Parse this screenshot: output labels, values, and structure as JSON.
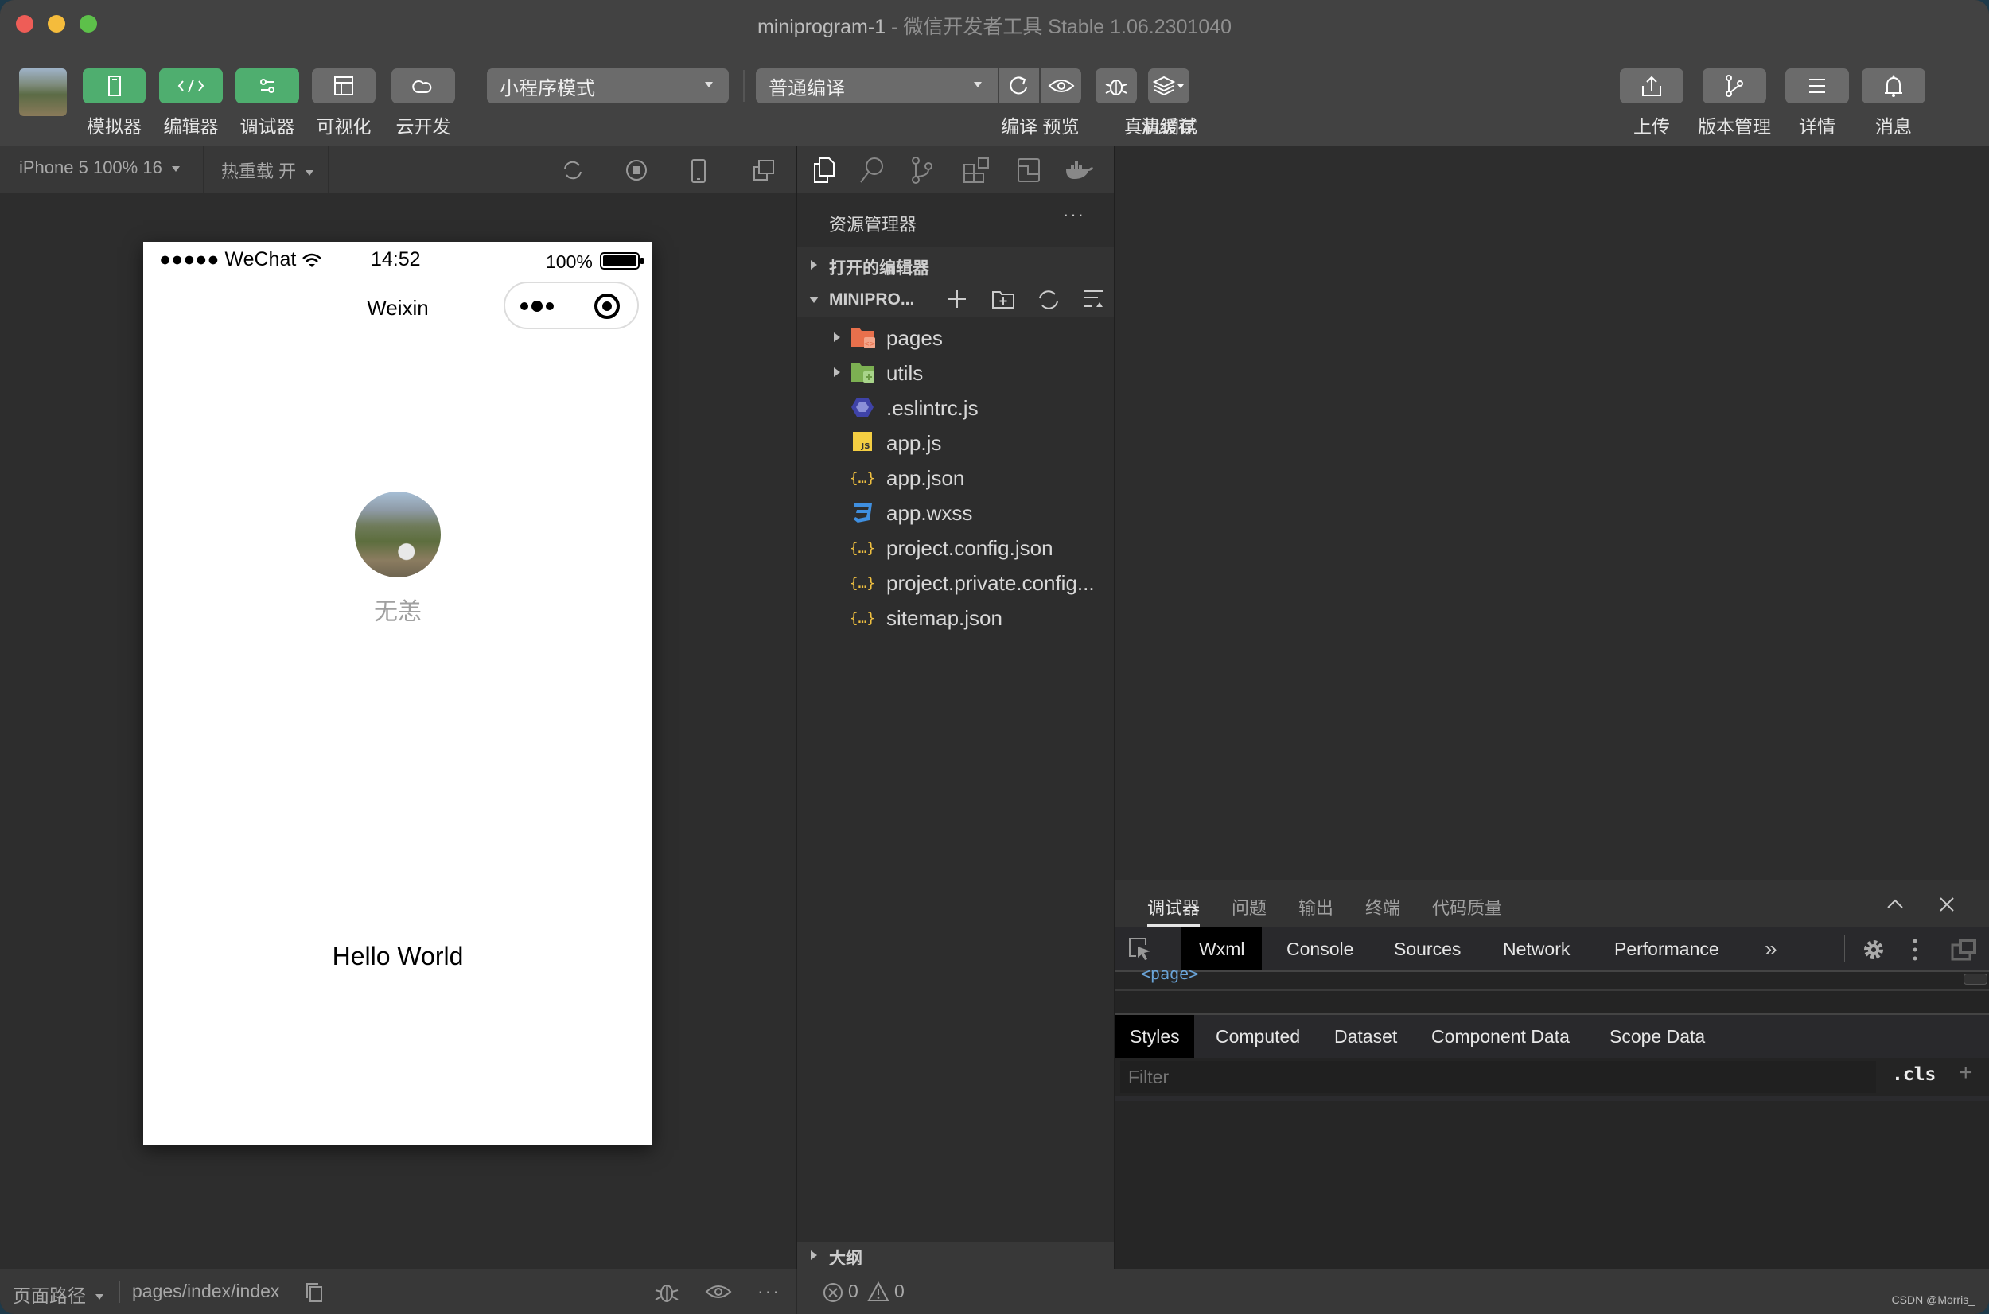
{
  "window": {
    "title_main": "miniprogram-1",
    "title_sub": " - 微信开发者工具 Stable 1.06.2301040"
  },
  "toolbar": {
    "left_buttons": [
      {
        "label": "模拟器",
        "icon": "phone-icon",
        "active": true
      },
      {
        "label": "编辑器",
        "icon": "code-icon",
        "active": true
      },
      {
        "label": "调试器",
        "icon": "debug-sliders-icon",
        "active": true
      },
      {
        "label": "可视化",
        "icon": "layout-icon",
        "active": false
      },
      {
        "label": "云开发",
        "icon": "cloud-icon",
        "active": false
      }
    ],
    "mode_select": "小程序模式",
    "compile_select": "普通编译",
    "center_buttons": [
      {
        "label": "编译",
        "icon": "refresh-icon"
      },
      {
        "label": "预览",
        "icon": "eye-icon"
      },
      {
        "label": "真机调试",
        "icon": "bug-icon"
      },
      {
        "label": "清缓存",
        "icon": "layers-icon"
      }
    ],
    "right_buttons": [
      {
        "label": "上传",
        "icon": "upload-icon"
      },
      {
        "label": "版本管理",
        "icon": "branch-icon"
      },
      {
        "label": "详情",
        "icon": "menu-icon"
      },
      {
        "label": "消息",
        "icon": "bell-icon"
      }
    ],
    "accent_color": "#4fae6f"
  },
  "simulator": {
    "device_select": "iPhone 5 100% 16",
    "hot_reload": "热重载 开",
    "phone": {
      "status_left": "●●●●● WeChat",
      "time": "14:52",
      "battery": "100%",
      "nav_title": "Weixin",
      "nickname": "无恙",
      "body_text": "Hello World"
    }
  },
  "explorer": {
    "header": "资源管理器",
    "more": "···",
    "open_editors": "打开的编辑器",
    "project": "MINIPRO...",
    "files": [
      {
        "name": "pages",
        "type": "folder-pages",
        "expandable": true
      },
      {
        "name": "utils",
        "type": "folder-utils",
        "expandable": true
      },
      {
        "name": ".eslintrc.js",
        "type": "eslint",
        "expandable": false
      },
      {
        "name": "app.js",
        "type": "js",
        "expandable": false
      },
      {
        "name": "app.json",
        "type": "json",
        "expandable": false
      },
      {
        "name": "app.wxss",
        "type": "css",
        "expandable": false
      },
      {
        "name": "project.config.json",
        "type": "json",
        "expandable": false
      },
      {
        "name": "project.private.config...",
        "type": "json",
        "expandable": false
      },
      {
        "name": "sitemap.json",
        "type": "json",
        "expandable": false
      }
    ],
    "outline": "大纲",
    "errors": "0",
    "warnings": "0"
  },
  "debugger": {
    "tabs": [
      "调试器",
      "问题",
      "输出",
      "终端",
      "代码质量"
    ],
    "active_tab": "调试器",
    "devtools_tabs": [
      "Wxml",
      "Console",
      "Sources",
      "Network",
      "Performance"
    ],
    "devtools_more": "»",
    "wxml_snippet": "<page>",
    "style_tabs": [
      "Styles",
      "Computed",
      "Dataset",
      "Component Data",
      "Scope Data"
    ],
    "filter_placeholder": "Filter",
    "cls": ".cls",
    "plus": "+"
  },
  "statusbar": {
    "page_path_label": "页面路径",
    "page_path": "pages/index/index",
    "more": "···"
  },
  "watermark": "CSDN @Morris_"
}
